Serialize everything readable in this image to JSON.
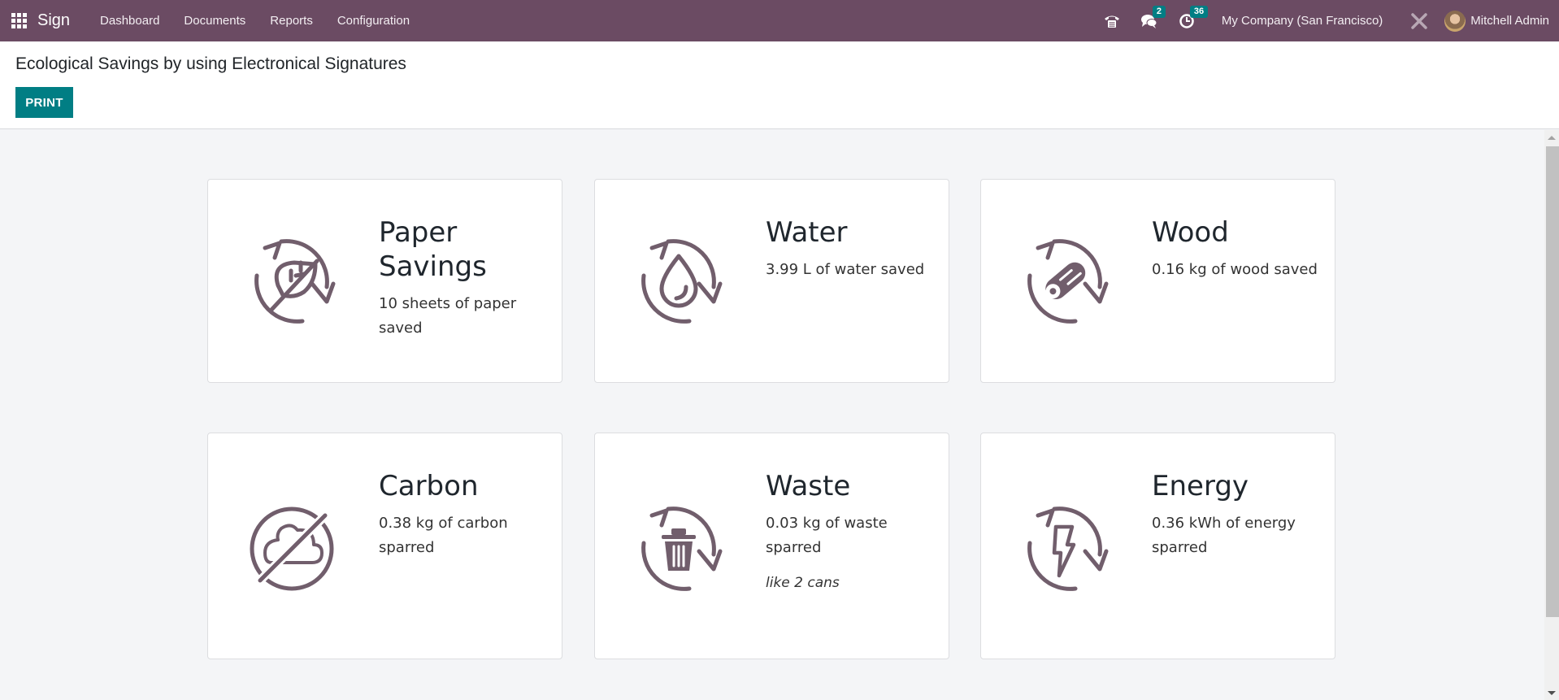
{
  "navbar": {
    "app_name": "Sign",
    "menu": [
      {
        "label": "Dashboard"
      },
      {
        "label": "Documents"
      },
      {
        "label": "Reports"
      },
      {
        "label": "Configuration"
      }
    ],
    "icons": {
      "phone": "phone-icon",
      "messages": "chat-icon",
      "activities": "clock-icon",
      "debug": "tools-icon"
    },
    "messages_count": "2",
    "activities_count": "36",
    "company": "My Company (San Francisco)",
    "user_name": "Mitchell Admin",
    "bg_color": "#6b4b63",
    "badge_color": "#017e84"
  },
  "control_panel": {
    "title": "Ecological Savings by using Electronical Signatures",
    "print_label": "PRINT",
    "print_color": "#017e84"
  },
  "cards": [
    {
      "id": "paper",
      "title": "Paper Savings",
      "desc": "10 sheets of paper saved",
      "icon": "leaf-recycle-icon"
    },
    {
      "id": "water",
      "title": "Water",
      "desc": "3.99 L of water saved",
      "icon": "water-drop-recycle-icon"
    },
    {
      "id": "wood",
      "title": "Wood",
      "desc": "0.16 kg of wood saved",
      "icon": "wood-log-recycle-icon"
    },
    {
      "id": "carbon",
      "title": "Carbon",
      "desc": "0.38 kg of carbon sparred",
      "icon": "no-cloud-icon"
    },
    {
      "id": "waste",
      "title": "Waste",
      "desc": "0.03 kg of waste sparred",
      "note": "like 2 cans",
      "icon": "trash-recycle-icon"
    },
    {
      "id": "energy",
      "title": "Energy",
      "desc": "0.36 kWh of energy sparred",
      "icon": "lightning-recycle-icon"
    }
  ],
  "icon_color": "#715e6c"
}
